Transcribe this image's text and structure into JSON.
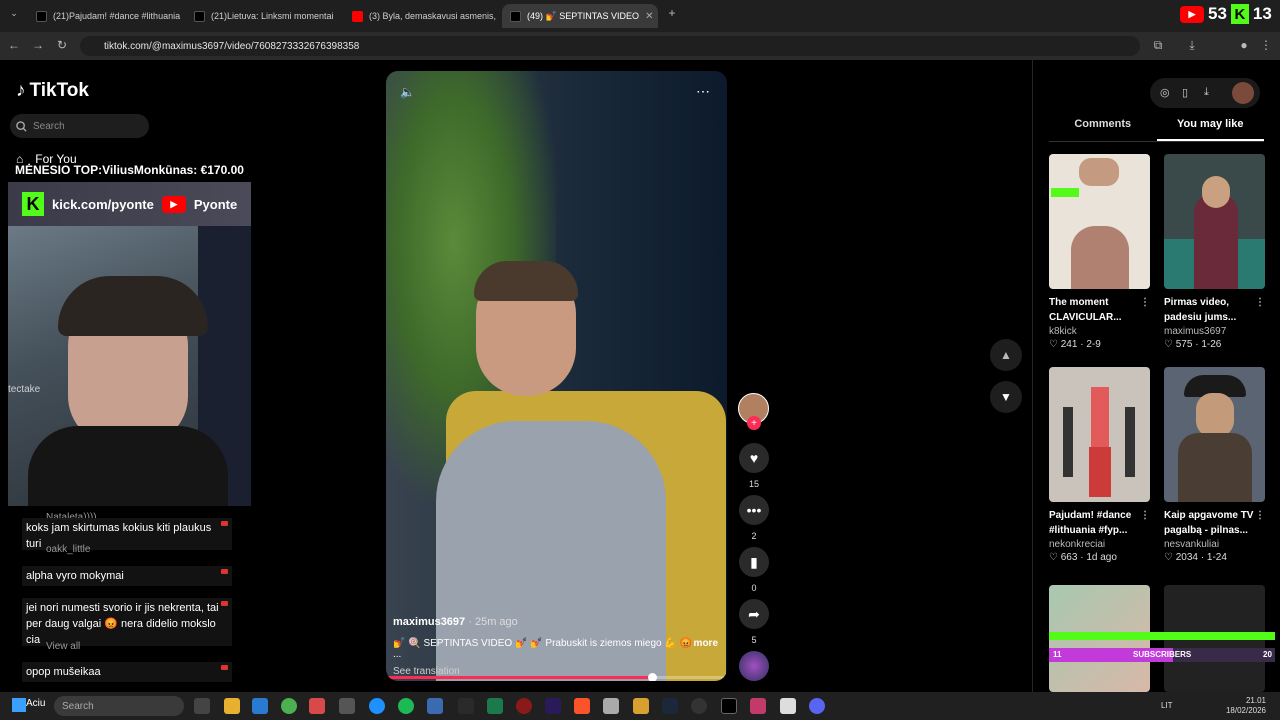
{
  "browser": {
    "tabs": [
      {
        "label": "(21)Pajudam! #dance #lithuania",
        "favicon": "tiktok-icon"
      },
      {
        "label": "(21)Lietuva: Linksmi momentai",
        "favicon": "tiktok-icon"
      },
      {
        "label": "(3) Byla, demaskavusi asmenis,",
        "favicon": "youtube-icon"
      },
      {
        "label": "(49) 💅 SEPTINTAS VIDEO",
        "favicon": "tiktok-icon"
      }
    ],
    "url": "tiktok.com/@maximus3697/video/7608273332676398358"
  },
  "tiktok": {
    "logo": "TikTok",
    "search_placeholder": "Search",
    "nav_for_you": "For You"
  },
  "stream_overlay": {
    "top_banner": "MĖNESIO TOP:ViliusMonkūnas: €170.00",
    "kick_link": "kick.com/pyonte",
    "youtube_name": "Pyonte",
    "webcam_text": "tectake",
    "top_right_count": "53",
    "top_right_count2": "13",
    "subscribers_label": "SUBSCRIBERS",
    "subscribers_current": "11",
    "subscribers_goal": "20"
  },
  "chat": {
    "messages": [
      {
        "text": "koks jam skirtumas kokius kiti plaukus turi"
      },
      {
        "text": "alpha vyro mokymai"
      },
      {
        "text": "jei nori numesti svorio ir jis nekrenta, tai per daug valgai 😡 nera didelio mokslo cia"
      },
      {
        "text": "opop mušeikaa"
      }
    ],
    "ghost_names": [
      "Nataleta))))",
      "oakk_little",
      "View all"
    ]
  },
  "video": {
    "author": "maximus3697",
    "time_ago": "· 25m ago",
    "caption": "💅 🍭 SEPTINTAS VIDEO 💅 💅 Prabuskit is ziemos miego 💪 😡 ...",
    "more": "more",
    "see_translation": "See translation",
    "progress": 0.78
  },
  "actions": {
    "likes": "15",
    "comments": "2",
    "saves": "0",
    "shares": "5"
  },
  "side_panel": {
    "tabs": [
      "Comments",
      "You may like"
    ],
    "active_tab": 1,
    "cards": [
      {
        "title": "The moment CLAVICULAR...",
        "author": "k8kick",
        "likes": "241",
        "age": "2-9",
        "thumb_color": "#e9e3da"
      },
      {
        "title": "Pirmas video, padesiu jums...",
        "author": "maximus3697",
        "likes": "575",
        "age": "1-26",
        "thumb_color": "#3a4a4a"
      },
      {
        "title": "Pajudam! #dance #lithuania #fyp...",
        "author": "nekonkreciai",
        "likes": "663",
        "age": "1d ago",
        "thumb_color": "#c9c3bb"
      },
      {
        "title": "Kaip apgavome TV pagalbą - pilnas...",
        "author": "nesvankuliai",
        "likes": "2034",
        "age": "1-24",
        "thumb_color": "#5a6472"
      }
    ]
  },
  "taskbar": {
    "start_label": "Aciu",
    "search_placeholder": "Search",
    "lang": "LIT",
    "time": "21.01",
    "date": "18/02/2026"
  },
  "colors": {
    "accent": "#fe2c55",
    "kick": "#53fc18",
    "youtube": "#ff0000"
  }
}
